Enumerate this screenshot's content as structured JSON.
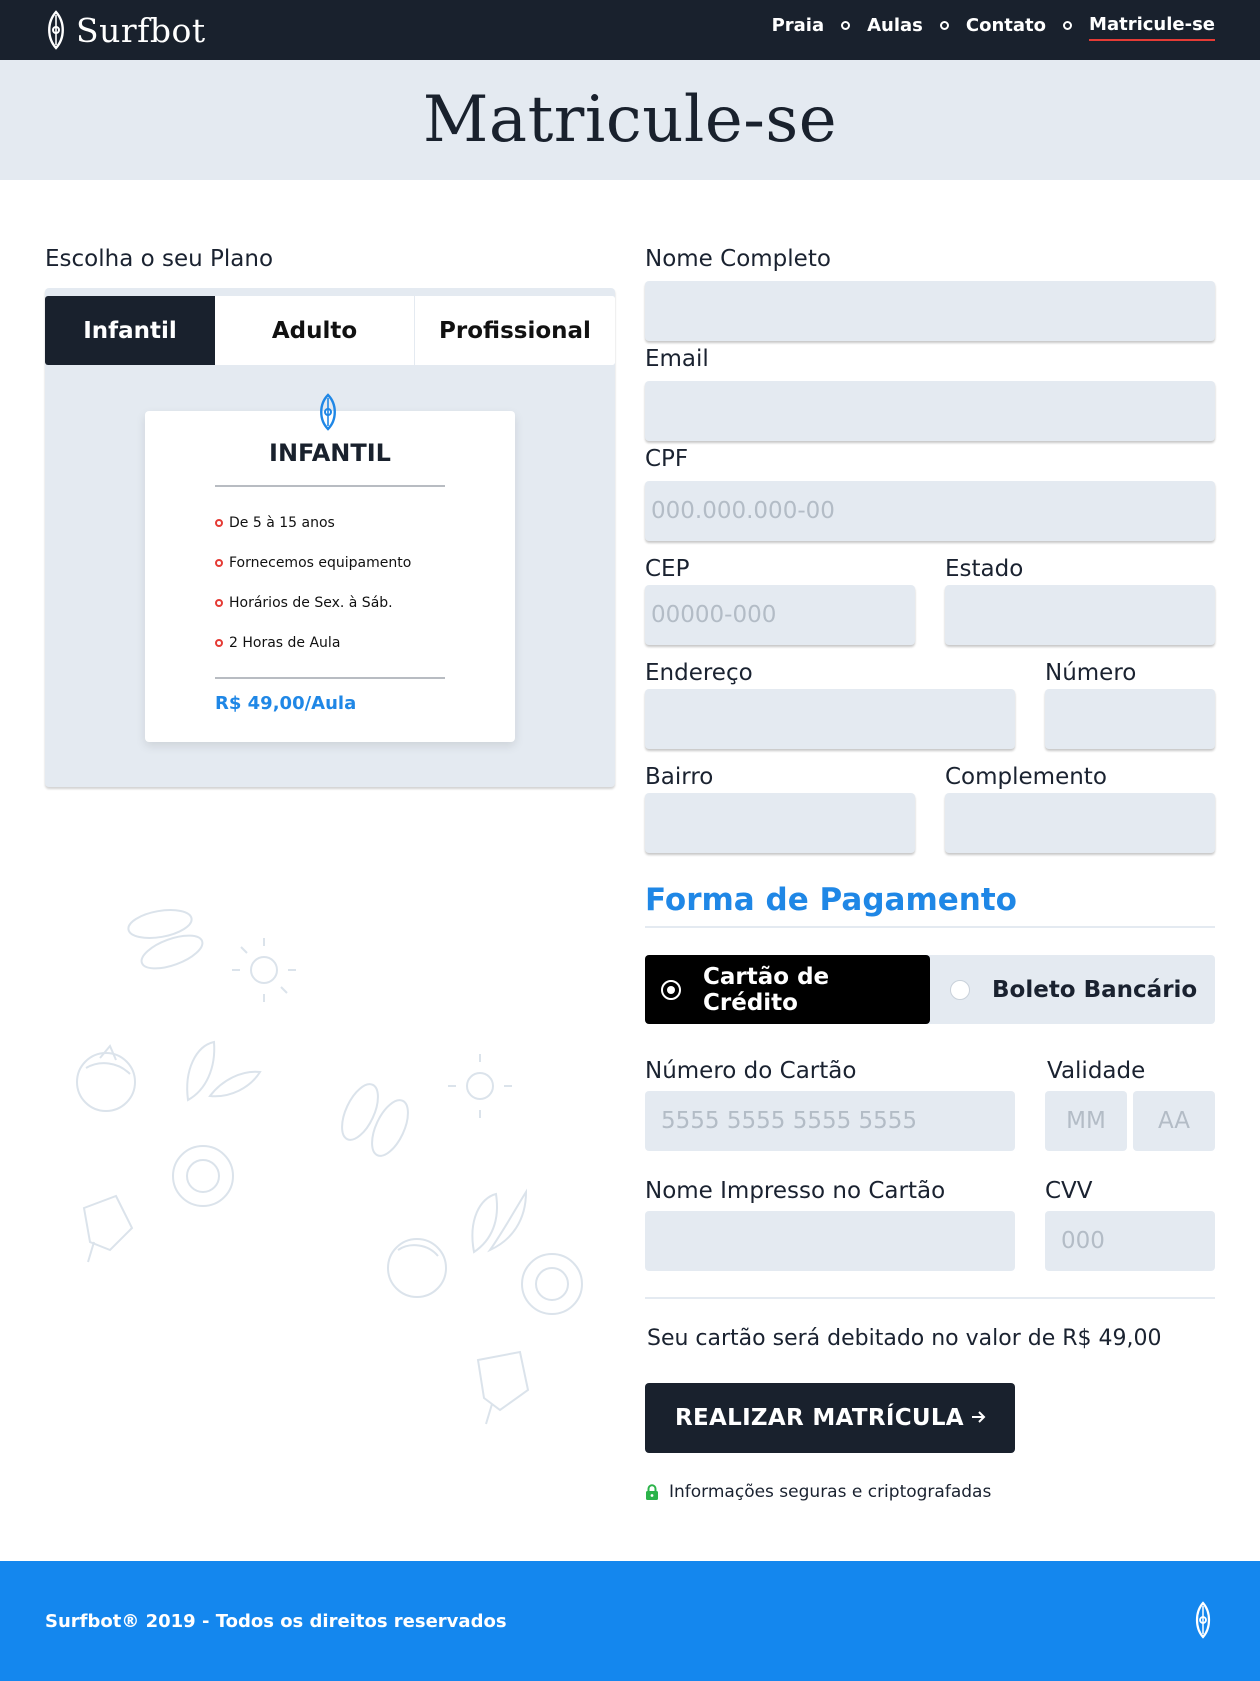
{
  "brand": {
    "name": "Surfbot"
  },
  "nav": {
    "items": [
      {
        "label": "Praia"
      },
      {
        "label": "Aulas"
      },
      {
        "label": "Contato"
      },
      {
        "label": "Matricule-se",
        "active": true
      }
    ]
  },
  "hero": {
    "title": "Matricule-se"
  },
  "plan": {
    "heading": "Escolha o seu Plano",
    "tabs": [
      {
        "label": "Infantil",
        "selected": true
      },
      {
        "label": "Adulto"
      },
      {
        "label": "Profissional"
      }
    ],
    "card": {
      "title": "INFANTIL",
      "features": [
        "De 5 à 15 anos",
        "Fornecemos equipamento",
        "Horários de Sex. à Sáb.",
        "2 Horas de Aula"
      ],
      "price": "R$ 49,00/Aula"
    }
  },
  "form": {
    "full_name": {
      "label": "Nome Completo",
      "value": "",
      "placeholder": ""
    },
    "email": {
      "label": "Email",
      "value": "",
      "placeholder": ""
    },
    "cpf": {
      "label": "CPF",
      "value": "",
      "placeholder": "000.000.000-00"
    },
    "cep": {
      "label": "CEP",
      "value": "",
      "placeholder": "00000-000"
    },
    "state": {
      "label": "Estado",
      "value": "",
      "placeholder": ""
    },
    "address": {
      "label": "Endereço",
      "value": "",
      "placeholder": ""
    },
    "number": {
      "label": "Número",
      "value": "",
      "placeholder": ""
    },
    "district": {
      "label": "Bairro",
      "value": "",
      "placeholder": ""
    },
    "complement": {
      "label": "Complemento",
      "value": "",
      "placeholder": ""
    }
  },
  "payment": {
    "title": "Forma de Pagamento",
    "options": [
      {
        "label": "Cartão de Crédito",
        "selected": true
      },
      {
        "label": "Boleto Bancário",
        "selected": false
      }
    ],
    "card_number": {
      "label": "Número do Cartão",
      "placeholder": "5555 5555 5555 5555"
    },
    "validity": {
      "label": "Validade",
      "month_placeholder": "MM",
      "year_placeholder": "AA"
    },
    "card_name": {
      "label": "Nome Impresso no Cartão",
      "placeholder": ""
    },
    "cvv": {
      "label": "CVV",
      "placeholder": "000"
    },
    "debit_note": "Seu cartão será debitado no valor de R$ 49,00",
    "submit_label": "REALIZAR MATRÍCULA",
    "secure_note": "Informações seguras e criptografadas"
  },
  "footer": {
    "text": "Surfbot® 2019 - Todos os direitos reservados"
  },
  "colors": {
    "dark": "#19212d",
    "accent_blue": "#1f87e6",
    "footer_blue": "#1487ee",
    "field_bg": "#e4eaf1",
    "active_underline": "#e53b35",
    "secure_lock": "#2bb34a"
  },
  "icons": {
    "logo": "surfboard-icon",
    "arrow": "arrow-right-icon",
    "secure": "lock-icon",
    "doodles": [
      "flip-flops-icon",
      "sun-icon",
      "coconut-icon",
      "surfboards-icon",
      "lifebuoy-icon",
      "popsicle-icon"
    ]
  }
}
